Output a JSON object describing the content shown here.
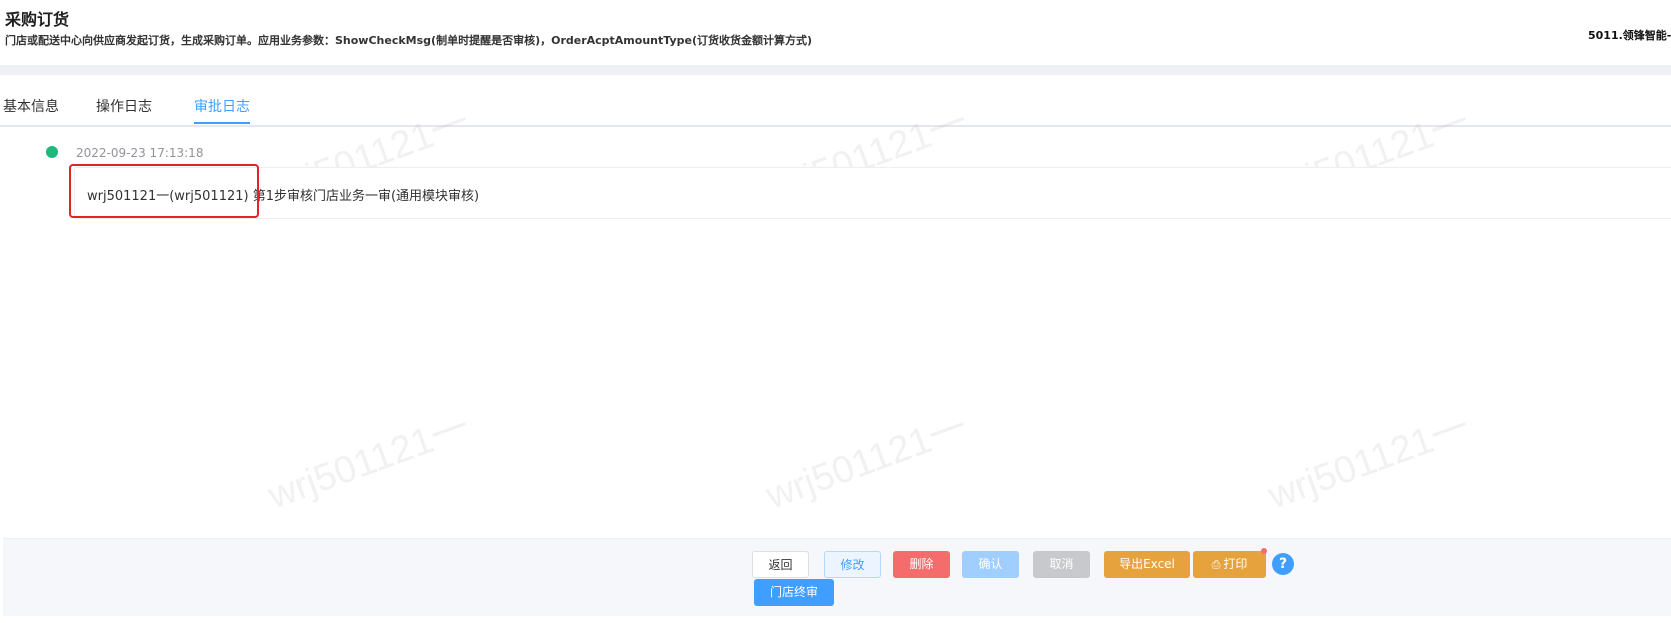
{
  "header": {
    "title": "采购订货",
    "description": "门店或配送中心向供应商发起订货，生成采购订单。应用业务参数：ShowCheckMsg(制单时提醒是否审核)，OrderAcptAmountType(订货收货金额计算方式)",
    "org": "5011.领锋智能-"
  },
  "tabs": [
    {
      "label": "基本信息"
    },
    {
      "label": "操作日志"
    },
    {
      "label": "审批日志"
    }
  ],
  "timeline": {
    "entries": [
      {
        "time": "2022-09-23 17:13:18",
        "content": "wrj501121一(wrj501121) 第1步审核门店业务一审(通用模块审核)"
      }
    ]
  },
  "watermark": "wrj501121一",
  "footer": {
    "back": "返回",
    "edit": "修改",
    "delete": "删除",
    "confirm": "确认",
    "cancel": "取消",
    "export": "导出Excel",
    "print": "打印",
    "help": "?",
    "store_final": "门店终审"
  },
  "colors": {
    "primary": "#409eff",
    "danger": "#f56c6c",
    "warning": "#e6a23c",
    "success": "#1fba7b",
    "highlight": "#e32424"
  }
}
